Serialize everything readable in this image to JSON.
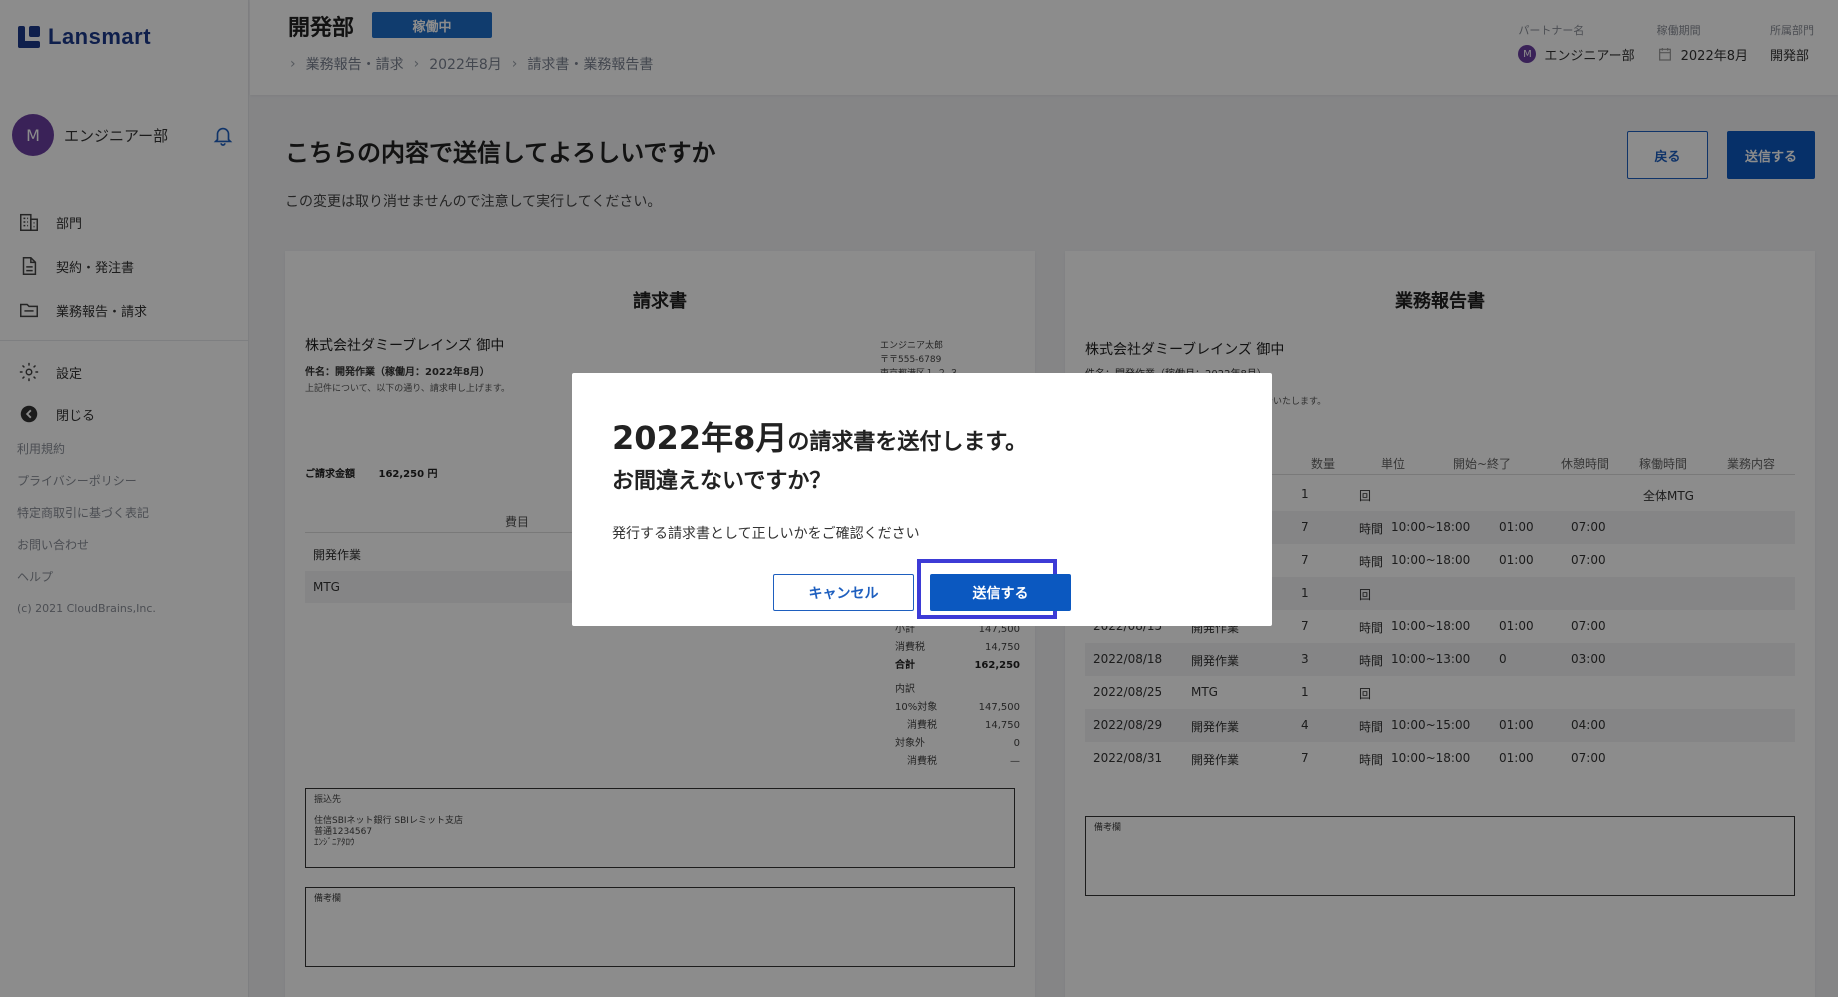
{
  "brand": {
    "name": "Lansmart"
  },
  "user": {
    "avatar_initial": "M",
    "name": "エンジニアー部"
  },
  "sidebar": {
    "items": [
      {
        "label": "部門",
        "icon": "building-icon"
      },
      {
        "label": "契約・発注書",
        "icon": "document-icon"
      },
      {
        "label": "業務報告・請求",
        "icon": "folder-icon"
      }
    ],
    "settings_label": "設定",
    "close_label": "閉じる",
    "links": [
      "利用規約",
      "プライバシーポリシー",
      "特定商取引に基づく表記",
      "お問い合わせ",
      "ヘルプ"
    ],
    "copyright": "(c) 2021 CloudBrains,Inc."
  },
  "header": {
    "title": "開発部",
    "status": "稼働中",
    "breadcrumb": [
      "業務報告・請求",
      "2022年8月",
      "請求書・業務報告書"
    ],
    "meta": {
      "partner_label": "パートナー名",
      "partner_initial": "M",
      "partner_value": "エンジニアー部",
      "period_label": "稼働期間",
      "period_value": "2022年8月",
      "dept_label": "所属部門",
      "dept_value": "開発部"
    }
  },
  "main": {
    "title": "こちらの内容で送信してよろしいですか",
    "subtitle": "この変更は取り消せませんので注意して実行してください。",
    "back_label": "戻る",
    "send_label": "送信する"
  },
  "invoice": {
    "title": "請求書",
    "client": "株式会社ダミーブレインズ 御中",
    "subject": "件名：開発作業（稼働月：2022年8月）",
    "note": "上記件について、以下の通り、請求申し上げます。",
    "issuer": [
      "エンジニア太郎",
      "〒〒555-6789",
      "東京都港区１-２-３"
    ],
    "amount_label": "ご請求金額",
    "amount_value": "162,250 円",
    "col_item": "費目",
    "rows": [
      "開発作業",
      "MTG"
    ],
    "totals": [
      {
        "label": "小計",
        "value": "147,500"
      },
      {
        "label": "消費税",
        "value": "14,750"
      },
      {
        "label": "合計",
        "value": "162,250"
      },
      {
        "label": "内訳",
        "value": ""
      },
      {
        "label": "10%対象",
        "value": "147,500"
      },
      {
        "label": "消費税",
        "value": "14,750"
      },
      {
        "label": "対象外",
        "value": "0"
      },
      {
        "label": "消費税",
        "value": "—"
      }
    ],
    "bank_label": "振込先",
    "bank_lines": [
      "住信SBIネット銀行 SBIレミット支店",
      "普通1234567",
      "ｴﾝｼﾞﾆｱﾀﾛｳ"
    ],
    "remark_label": "備考欄"
  },
  "report": {
    "title": "業務報告書",
    "client": "株式会社ダミーブレインズ 御中",
    "line1": "件名：開発作業（稼働月：2022年8月）",
    "line2": "報告いたします。",
    "headers": [
      "数量",
      "単位",
      "開始~終了",
      "休憩時間",
      "稼働時間",
      "業務内容"
    ],
    "rows": [
      {
        "date": "",
        "item": "",
        "qty": "1",
        "unit": "回",
        "range": "",
        "break": "",
        "work": "",
        "content": "全体MTG"
      },
      {
        "date": "",
        "item": "",
        "qty": "7",
        "unit": "時間",
        "range": "10:00~18:00",
        "break": "01:00",
        "work": "07:00",
        "content": ""
      },
      {
        "date": "",
        "item": "",
        "qty": "7",
        "unit": "時間",
        "range": "10:00~18:00",
        "break": "01:00",
        "work": "07:00",
        "content": ""
      },
      {
        "date": "",
        "item": "",
        "qty": "1",
        "unit": "回",
        "range": "",
        "break": "",
        "work": "",
        "content": ""
      },
      {
        "date": "2022/08/15",
        "item": "開発作業",
        "qty": "7",
        "unit": "時間",
        "range": "10:00~18:00",
        "break": "01:00",
        "work": "07:00",
        "content": ""
      },
      {
        "date": "2022/08/18",
        "item": "開発作業",
        "qty": "3",
        "unit": "時間",
        "range": "10:00~13:00",
        "break": "0",
        "work": "03:00",
        "content": ""
      },
      {
        "date": "2022/08/25",
        "item": "MTG",
        "qty": "1",
        "unit": "回",
        "range": "",
        "break": "",
        "work": "",
        "content": ""
      },
      {
        "date": "2022/08/29",
        "item": "開発作業",
        "qty": "4",
        "unit": "時間",
        "range": "10:00~15:00",
        "break": "01:00",
        "work": "04:00",
        "content": ""
      },
      {
        "date": "2022/08/31",
        "item": "開発作業",
        "qty": "7",
        "unit": "時間",
        "range": "10:00~18:00",
        "break": "01:00",
        "work": "07:00",
        "content": ""
      }
    ],
    "remark_label": "備考欄"
  },
  "modal": {
    "title_big": "2022年8月",
    "title_rest": "の請求書を送付します。",
    "title_line2": "お間違えないですか？",
    "body": "発行する請求書として正しいかをご確認ください",
    "cancel_label": "キャンセル",
    "confirm_label": "送信する"
  }
}
